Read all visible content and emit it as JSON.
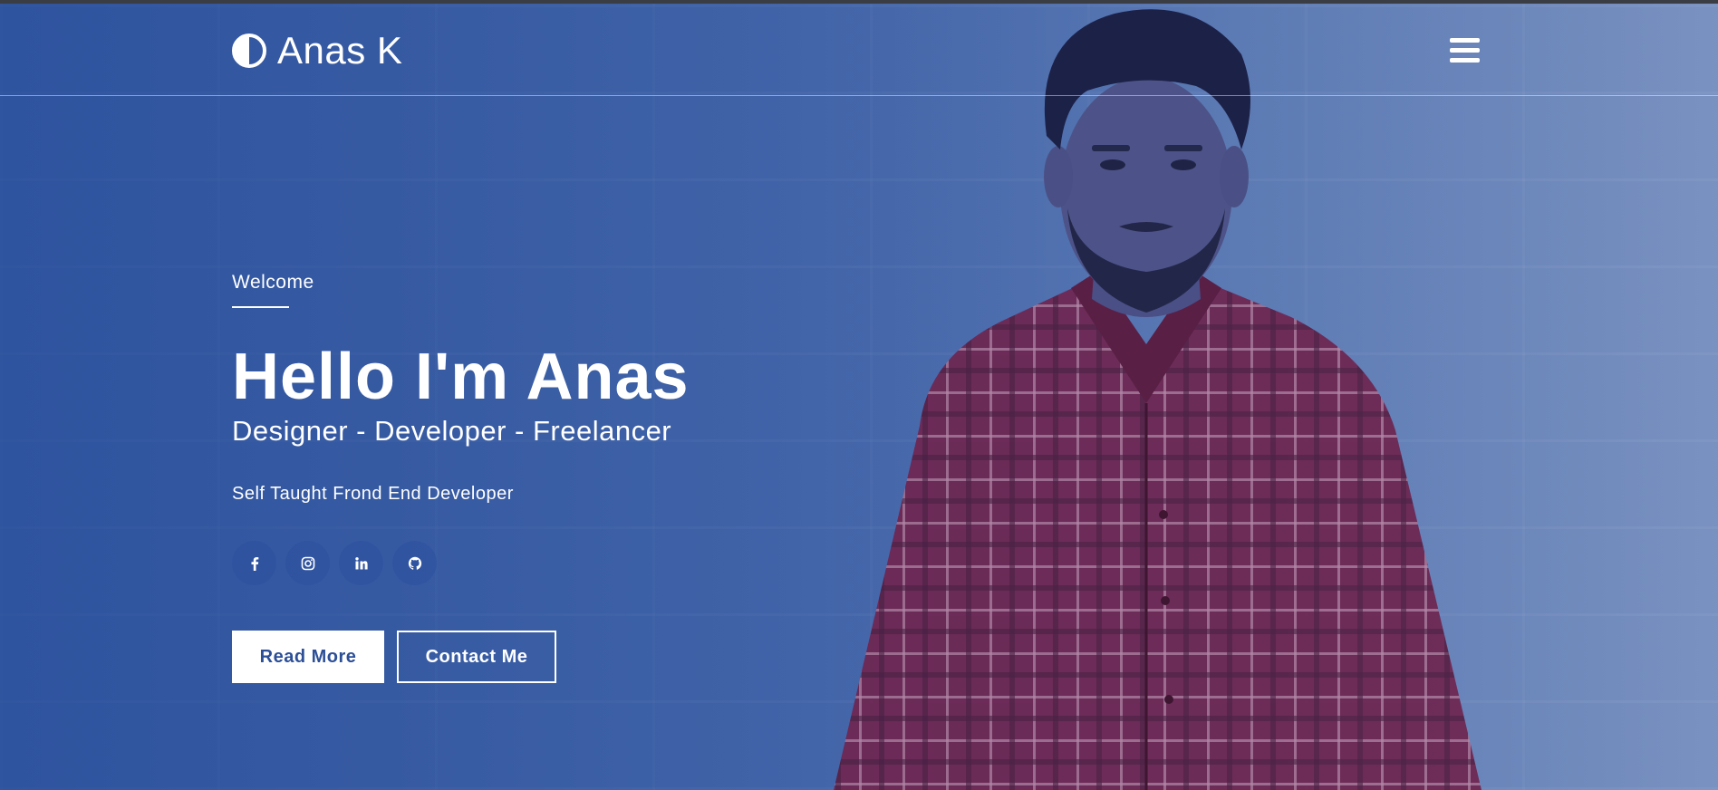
{
  "header": {
    "brand_name": "Anas K",
    "brand_icon": "half-circle-icon",
    "menu_icon": "hamburger-menu-icon"
  },
  "hero": {
    "welcome": "Welcome",
    "title": "Hello I'm Anas",
    "subtitle": "Designer - Developer - Freelancer",
    "tagline": "Self Taught Frond End Developer",
    "socials": [
      {
        "icon": "facebook-icon"
      },
      {
        "icon": "instagram-icon"
      },
      {
        "icon": "linkedin-icon"
      },
      {
        "icon": "github-icon"
      }
    ],
    "buttons": {
      "read_more": "Read More",
      "contact_me": "Contact Me"
    }
  },
  "colors": {
    "overlay_blue": "#3f63a6",
    "button_text": "#2c4f97",
    "shirt": "#7a2d55"
  }
}
